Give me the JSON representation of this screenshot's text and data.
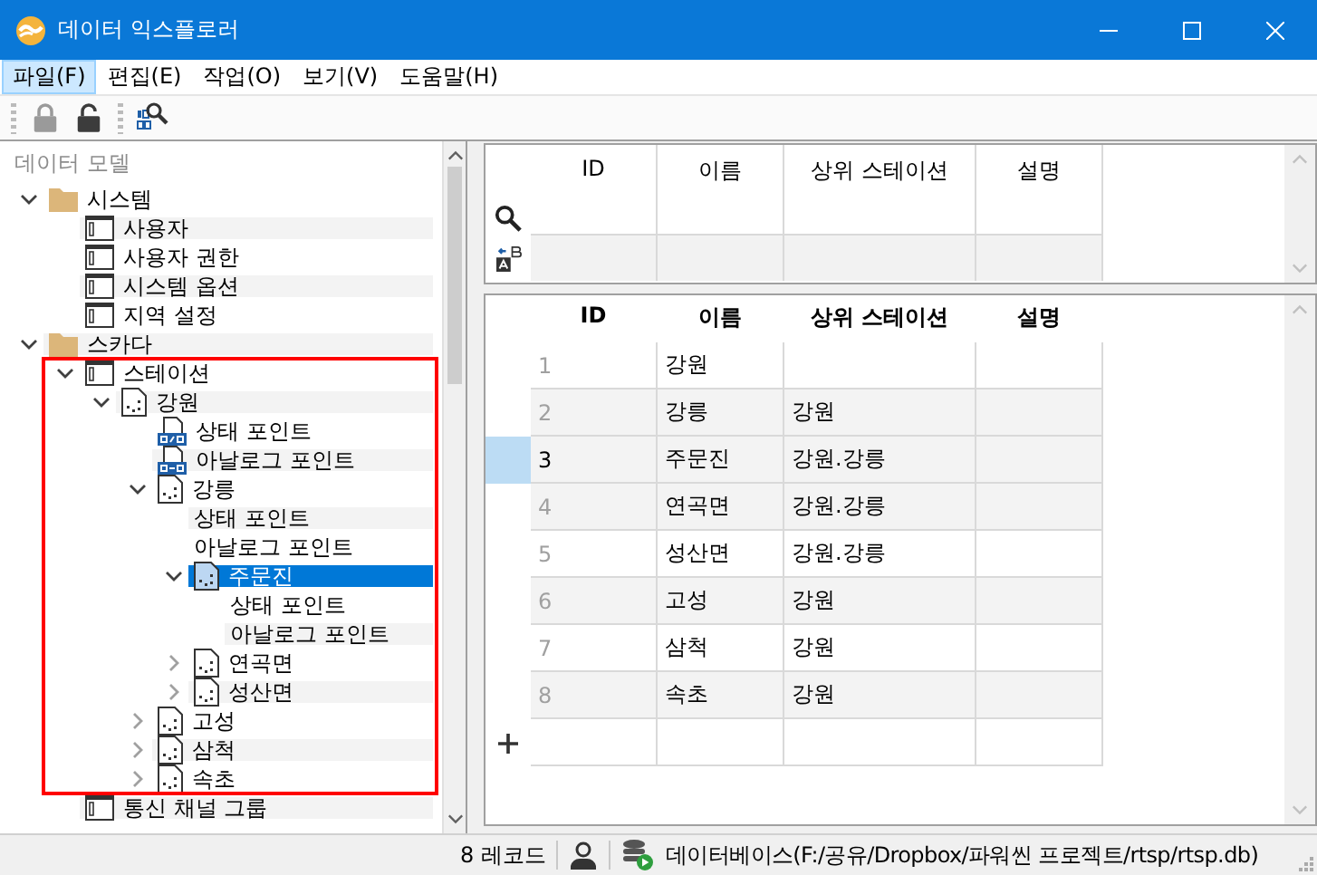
{
  "window": {
    "title": "데이터 익스플로러"
  },
  "menu": [
    {
      "label": "파일(F)",
      "selected": true
    },
    {
      "label": "편집(E)",
      "selected": false
    },
    {
      "label": "작업(O)",
      "selected": false
    },
    {
      "label": "보기(V)",
      "selected": false
    },
    {
      "label": "도움말(H)",
      "selected": false
    }
  ],
  "toolbar": [
    {
      "kind": "lock",
      "disabled": true
    },
    {
      "kind": "unlock",
      "disabled": false
    },
    {
      "kind": "binary-search",
      "disabled": false
    }
  ],
  "tree": {
    "title": "데이터 모델",
    "items": [
      {
        "label": "시스템",
        "kind": "folder",
        "expanded": true,
        "selected": false,
        "children": [
          {
            "label": "사용자",
            "kind": "table",
            "selected": false
          },
          {
            "label": "사용자 권한",
            "kind": "table",
            "selected": false
          },
          {
            "label": "시스템 옵션",
            "kind": "table",
            "selected": false
          },
          {
            "label": "지역 설정",
            "kind": "table",
            "selected": false
          }
        ]
      },
      {
        "label": "스카다",
        "kind": "folder",
        "expanded": true,
        "selected": false,
        "children": [
          {
            "label": "스테이션",
            "kind": "table",
            "expanded": true,
            "selected": false,
            "children": [
              {
                "label": "강원",
                "kind": "station",
                "expanded": true,
                "selected": false,
                "children": [
                  {
                    "label": "상태 포인트",
                    "kind": "status",
                    "selected": false
                  },
                  {
                    "label": "아날로그 포인트",
                    "kind": "analog",
                    "selected": false
                  },
                  {
                    "label": "강릉",
                    "kind": "station",
                    "expanded": true,
                    "selected": false,
                    "children": [
                      {
                        "label": "상태 포인트",
                        "selected": false
                      },
                      {
                        "label": "아날로그 포인트",
                        "selected": false
                      },
                      {
                        "label": "주문진",
                        "kind": "station",
                        "expanded": true,
                        "selected": true,
                        "children": [
                          {
                            "label": "상태 포인트",
                            "selected": false
                          },
                          {
                            "label": "아날로그 포인트",
                            "selected": false
                          }
                        ]
                      },
                      {
                        "label": "연곡면",
                        "kind": "station",
                        "expanded": false,
                        "selected": false
                      },
                      {
                        "label": "성산면",
                        "kind": "station",
                        "expanded": false,
                        "selected": false
                      }
                    ]
                  },
                  {
                    "label": "고성",
                    "kind": "station",
                    "expanded": false,
                    "selected": false
                  },
                  {
                    "label": "삼척",
                    "kind": "station",
                    "expanded": false,
                    "selected": false
                  },
                  {
                    "label": "속초",
                    "kind": "station",
                    "expanded": false,
                    "selected": false
                  }
                ]
              }
            ]
          },
          {
            "label": "통신 채널 그룹",
            "kind": "table",
            "selected": false
          }
        ]
      }
    ]
  },
  "filter_grid": {
    "columns": [
      "ID",
      "이름",
      "상위 스테이션",
      "설명"
    ]
  },
  "grid": {
    "columns": [
      "ID",
      "이름",
      "상위 스테이션",
      "설명"
    ],
    "rows": [
      {
        "id": "1",
        "name": "강원",
        "selected": false
      },
      {
        "id": "2",
        "name": "강릉",
        "parent": "강원",
        "selected": false
      },
      {
        "id": "3",
        "name": "주문진",
        "parent": "강원.강릉",
        "selected": true
      },
      {
        "id": "4",
        "name": "연곡면",
        "parent": "강원.강릉",
        "selected": false
      },
      {
        "id": "5",
        "name": "성산면",
        "parent": "강원.강릉",
        "selected": false
      },
      {
        "id": "6",
        "name": "고성",
        "parent": "강원",
        "selected": false
      },
      {
        "id": "7",
        "name": "삼척",
        "parent": "강원",
        "selected": false
      },
      {
        "id": "8",
        "name": "속초",
        "parent": "강원",
        "selected": false
      }
    ]
  },
  "status_bar": {
    "records": "8 레코드",
    "database": "데이터베이스(F:/공유/Dropbox/파워씬 프로젝트/rtsp/rtsp.db)"
  }
}
